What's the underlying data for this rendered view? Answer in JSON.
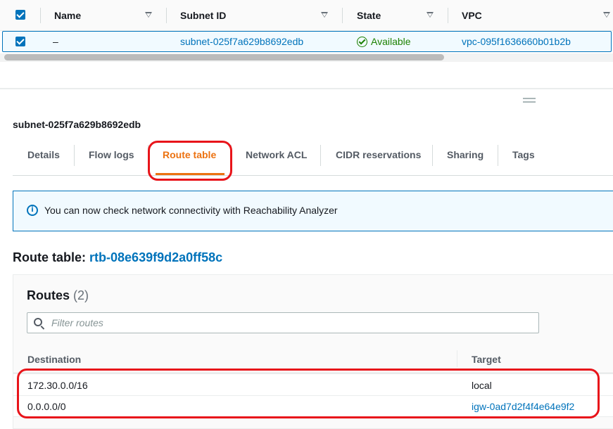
{
  "subnets_table": {
    "columns": [
      "Name",
      "Subnet ID",
      "State",
      "VPC"
    ],
    "rows": [
      {
        "name": "–",
        "subnet_id": "subnet-025f7a629b8692edb",
        "state": "Available",
        "vpc": "vpc-095f1636660b01b2b"
      }
    ]
  },
  "detail_panel": {
    "title": "subnet-025f7a629b8692edb",
    "tabs": [
      "Details",
      "Flow logs",
      "Route table",
      "Network ACL",
      "CIDR reservations",
      "Sharing",
      "Tags"
    ],
    "active_tab": "Route table"
  },
  "info_banner": {
    "text": "You can now check network connectivity with Reachability Analyzer"
  },
  "route_table": {
    "heading_label": "Route table:",
    "id": "rtb-08e639f9d2a0ff58c"
  },
  "routes": {
    "title": "Routes",
    "count": "(2)",
    "filter_placeholder": "Filter routes",
    "columns": [
      "Destination",
      "Target"
    ],
    "rows": [
      {
        "destination": "172.30.0.0/16",
        "target": "local"
      },
      {
        "destination": "0.0.0.0/0",
        "target": "igw-0ad7d2f4f4e64e9f2"
      }
    ]
  },
  "colors": {
    "link": "#0073bb",
    "active_tab": "#ec7211",
    "status_ok": "#1d8102",
    "highlight": "#e8141a"
  }
}
